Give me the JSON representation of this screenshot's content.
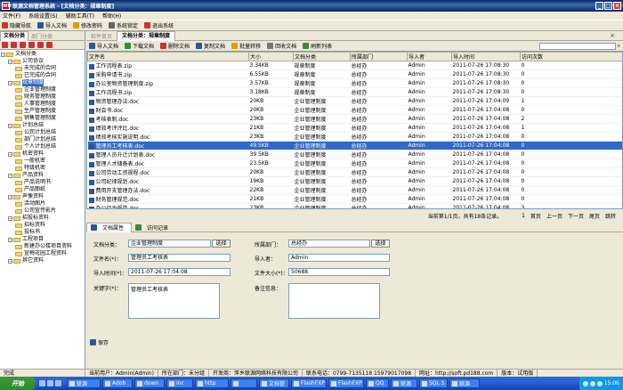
{
  "window": {
    "logo": "WD",
    "title": "联源文档管理系统 - [文档分类：规章制度]"
  },
  "menu": [
    "文件(F)",
    "系统设置(S)",
    "辅助工具(T)",
    "帮助(H)"
  ],
  "toolbar": [
    "隐藏导航",
    "导入文档",
    "修改密码",
    "系统锁定",
    "退出系统"
  ],
  "left": {
    "tab_active": "文档分类",
    "tab_inactive": "部门分类",
    "tree": [
      {
        "d": 0,
        "t": "文档分类"
      },
      {
        "d": 1,
        "t": "公司协议"
      },
      {
        "d": 2,
        "t": "未完成的合同"
      },
      {
        "d": 2,
        "t": "已完成的合同"
      },
      {
        "d": 1,
        "t": "规章制度",
        "sel": true
      },
      {
        "d": 2,
        "t": "企业管理制度"
      },
      {
        "d": 2,
        "t": "财务管理制度"
      },
      {
        "d": 2,
        "t": "人事管理制度"
      },
      {
        "d": 2,
        "t": "生产管理制度"
      },
      {
        "d": 2,
        "t": "销售管理制度"
      },
      {
        "d": 1,
        "t": "计划总结"
      },
      {
        "d": 2,
        "t": "公司计划总结"
      },
      {
        "d": 2,
        "t": "部门计划总结"
      },
      {
        "d": 2,
        "t": "个人计划总结"
      },
      {
        "d": 1,
        "t": "机密资料"
      },
      {
        "d": 2,
        "t": "一般机密"
      },
      {
        "d": 2,
        "t": "特级机密"
      },
      {
        "d": 1,
        "t": "产品资料"
      },
      {
        "d": 2,
        "t": "产品说明书"
      },
      {
        "d": 2,
        "t": "产品图纸"
      },
      {
        "d": 1,
        "t": "声像资料"
      },
      {
        "d": 2,
        "t": "活动图片"
      },
      {
        "d": 2,
        "t": "公司宣传影片"
      },
      {
        "d": 1,
        "t": "招投标资料"
      },
      {
        "d": 2,
        "t": "招标资料"
      },
      {
        "d": 2,
        "t": "投标书"
      },
      {
        "d": 1,
        "t": "工程项目"
      },
      {
        "d": 2,
        "t": "新建办公楼项目资料"
      },
      {
        "d": 2,
        "t": "宣梅花园工程资料"
      },
      {
        "d": 1,
        "t": "其它资料"
      }
    ]
  },
  "main": {
    "tab_inactive": "软件首页",
    "tab_active": "文档分类：规章制度",
    "close": "×",
    "toolbar": [
      "导入文档",
      "下载文档",
      "删除文档",
      "复制文档",
      "批量转移",
      "回收文档",
      "刷新列表"
    ],
    "search_placeholder": "",
    "columns": [
      "文件名",
      "大小",
      "文档分类",
      "所属部门",
      "导入者",
      "导入时间",
      "访问次数"
    ],
    "rows": [
      [
        "工作流程表.zip",
        "3.34KB",
        "规章制度",
        "总经办",
        "Admin",
        "2011-07-26 17:08:30",
        "0"
      ],
      [
        "采购申请书.zip",
        "6.55KB",
        "规章制度",
        "总经办",
        "Admin",
        "2011-07-26 17:08:30",
        "0"
      ],
      [
        "办公室物资管理制度.zip",
        "3.57KB",
        "规章制度",
        "总经办",
        "Admin",
        "2011-07-26 17:08:30",
        "0"
      ],
      [
        "工作流程书.zip",
        "3.18KB",
        "规章制度",
        "总经办",
        "Admin",
        "2011-07-26 17:08:30",
        "0"
      ],
      [
        "物资管理办法.doc",
        "20KB",
        "企业管理制度",
        "总经办",
        "Admin",
        "2011-07-26 17:04:09",
        "1"
      ],
      [
        "财会书.doc",
        "20KB",
        "企业管理制度",
        "总经办",
        "Admin",
        "2011-07-26 17:04:08",
        "0"
      ],
      [
        "考核表制.doc",
        "23KB",
        "企业管理制度",
        "总经办",
        "Admin",
        "2011-07-26 17:04:08",
        "2"
      ],
      [
        "绩效考评评比.doc",
        "21KB",
        "企业管理制度",
        "总经办",
        "Admin",
        "2011-07-26 17:04:08",
        "1"
      ],
      [
        "绩效考核实施说明.doc",
        "23KB",
        "企业管理制度",
        "总经办",
        "Admin",
        "2011-07-26 17:04:08",
        "0"
      ],
      [
        "管理员工考核表.doc",
        "49.5KB",
        "企业管理制度",
        "总经办",
        "Admin",
        "2011-07-26 17:04:08",
        "0"
      ],
      [
        "管理人员升迁计划表.doc",
        "39.5KB",
        "企业管理制度",
        "总经办",
        "Admin",
        "2011-07-26 17:04:08",
        "0"
      ],
      [
        "管理人才储备表.doc",
        "23.5KB",
        "企业管理制度",
        "总经办",
        "Admin",
        "2011-07-26 17:04:08",
        "0"
      ],
      [
        "公司劳动工资规程.doc",
        "20KB",
        "企业管理制度",
        "总经办",
        "Admin",
        "2011-07-26 17:04:08",
        "0"
      ],
      [
        "公司纪律规划.doc",
        "19KB",
        "企业管理制度",
        "总经办",
        "Admin",
        "2011-07-26 17:04:08",
        "0"
      ],
      [
        "费用开支管理办法.doc",
        "22KB",
        "企业管理制度",
        "总经办",
        "Admin",
        "2011-07-26 17:04:08",
        "0"
      ],
      [
        "财务管理规范.doc",
        "21KB",
        "企业管理制度",
        "总经办",
        "Admin",
        "2011-07-26 17:04:08",
        "0"
      ],
      [
        "办公行为规范.doc",
        "23KB",
        "企业管理制度",
        "总经办",
        "Admin",
        "2011-07-26 17:04:08",
        "3"
      ],
      [
        "中层领导年度工作考核.doc",
        "47.5KB",
        "企业管理制度",
        "总经办",
        "Admin",
        "2011-07-26 17:04:08",
        "0"
      ]
    ],
    "selected_row": 9
  },
  "pager": {
    "info": "当前第1/1页，共有18条记录。",
    "current": "1",
    "links": [
      "首页",
      "上一页",
      "下一页",
      "尾页",
      "跳转"
    ]
  },
  "detail": {
    "tabs": [
      "文档属性",
      "访问记录"
    ],
    "labels": {
      "category": "文档分类：",
      "filename": "文件名(*)：",
      "import_time": "导入时间(*)：",
      "keywords": "关键字(*)：",
      "department": "所属部门：",
      "importer": "导入者：",
      "size": "文件大小(*)：",
      "remarks": "备注信息："
    },
    "values": {
      "category": "企业管理制度",
      "filename": "管理员工考核表",
      "import_time": "2011-07-26 17:04:08",
      "keywords": "管理员工考核表",
      "department": "总经办",
      "importer": "Admin",
      "size": "50688",
      "remarks": ""
    },
    "choose": "选择",
    "save": "保存"
  },
  "status": [
    "完成",
    "当前用户：Admin(Admin)",
    "所在部门：未分组",
    "开发商：萍乡联源网络科技有限公司",
    "联系电话：0799-7135118 15979017098",
    "网址：http://soft.pd188.com",
    "版本：试用版"
  ],
  "taskbar": {
    "start": "开始",
    "tasks": [
      "联源",
      "Adob",
      "down",
      "inc",
      "http",
      "",
      "文档管",
      "FlashFXP",
      "FlashFXP",
      "QQ",
      "联源",
      "SQL S",
      "联源"
    ],
    "time": "15:06"
  },
  "colors": {
    "accent": "#316ac5",
    "title": "#0a246a"
  }
}
